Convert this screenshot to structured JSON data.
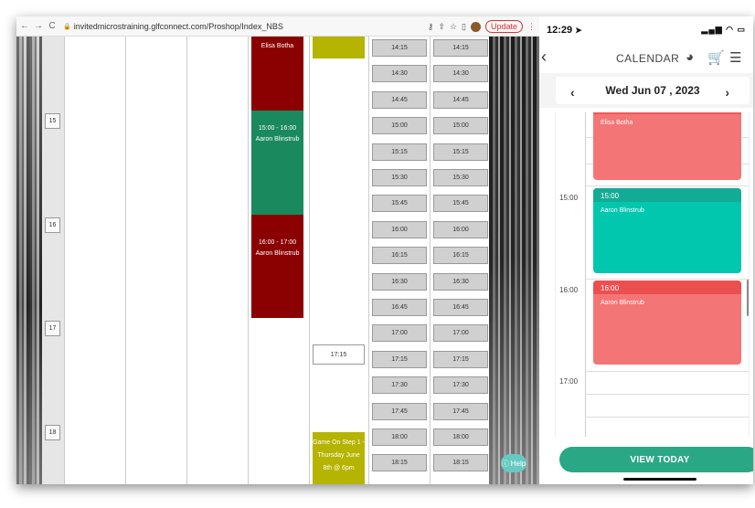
{
  "browser": {
    "url": "invitedmicrostraining.glfconnect.com/Proshop/Index_NBS",
    "update_label": "Update",
    "hours": [
      "15",
      "16",
      "17",
      "18"
    ],
    "bookings": [
      {
        "label1": "Elisa Botha",
        "label2": "",
        "color": "#8b0000"
      },
      {
        "label1": "15:00 - 16:00",
        "label2": "Aaron Blinstrub",
        "color": "#1a8a5e"
      },
      {
        "label1": "16:00 - 17:00",
        "label2": "Aaron Blinstrub",
        "color": "#8b0000"
      }
    ],
    "white_slot": "17:15",
    "game_on": "Game On Step 1 - Thursday June 8th @ 6pm",
    "slots": [
      "14:15",
      "14:30",
      "14:45",
      "15:00",
      "15:15",
      "15:30",
      "15:45",
      "16:00",
      "16:15",
      "16:30",
      "16:45",
      "17:00",
      "17:15",
      "17:30",
      "17:45",
      "18:00",
      "18:15"
    ],
    "help_label": "Help"
  },
  "phone": {
    "time": "12:29",
    "title": "CALENDAR",
    "date": "Wed Jun 07 , 2023",
    "time_labels": [
      "15:00",
      "16:00",
      "17:00"
    ],
    "events": [
      {
        "head": "",
        "name": "Elisa Botha",
        "color": "#f47575",
        "head_color": "#ee5a5a"
      },
      {
        "head": "15:00",
        "name": "Aaron Blinstrub",
        "color": "#00c7ae",
        "head_color": "#14ab94"
      },
      {
        "head": "16:00",
        "name": "Aaron Blinstrub",
        "color": "#f47575",
        "head_color": "#ec4f4f"
      }
    ],
    "view_today": "VIEW TODAY"
  }
}
